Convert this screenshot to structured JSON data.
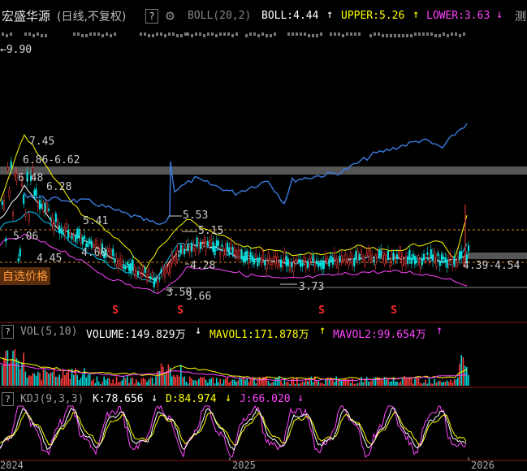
{
  "header": {
    "stock_name": "宏盛华源",
    "period": "(日线,不复权)",
    "help": "?",
    "indicator": "BOLL(20,2)",
    "boll_label": "BOLL:4.44",
    "upper_label": "UPPER:5.26",
    "lower_label": "LOWER:3.63",
    "trailing": "测",
    "colors": {
      "boll": "#ffffff",
      "upper": "#ffff00",
      "lower": "#ff44ff"
    }
  },
  "price_labels": {
    "max_price": "9.90",
    "h1": "7.45",
    "h2": "6.86-6.62",
    "h3": "6.48",
    "h4": "6.28",
    "h5": "5.41",
    "h6": "5.53",
    "h7": "5.15",
    "h8": "5.06",
    "h9": "4.45",
    "h10": "4.60",
    "h11": "4.28",
    "h12": "3.73",
    "h13": "3.50",
    "h14": "3.66",
    "h15": "4.39-4.54"
  },
  "self_select_label": "自选价格",
  "event_markers": [
    "S",
    "S",
    "S",
    "S"
  ],
  "volume_header": {
    "help": "?",
    "name": "VOL(5,10)",
    "volume": "VOLUME:149.829万",
    "mavol1": "MAVOL1:171.878万",
    "mavol2": "MAVOL2:99.654万"
  },
  "kdj_header": {
    "help": "?",
    "name": "KDJ(9,3,3)",
    "k": "K:78.656",
    "d": "D:84.974",
    "j": "J:66.020"
  },
  "x_axis": {
    "labels": [
      "2024",
      "2025",
      "2026"
    ]
  },
  "chart_data": [
    {
      "type": "line",
      "title": "BOLL(20,2)",
      "series": [
        {
          "name": "BOLL",
          "last": 4.44,
          "color": "#ffffff"
        },
        {
          "name": "UPPER",
          "last": 5.26,
          "color": "#ffff00"
        },
        {
          "name": "LOWER",
          "last": 3.63,
          "color": "#ff44ff"
        }
      ],
      "annotations": [
        9.9,
        7.45,
        6.86,
        6.62,
        6.48,
        6.28,
        5.41,
        5.53,
        5.15,
        5.06,
        4.45,
        4.6,
        4.28,
        3.73,
        3.5,
        3.66,
        4.39,
        4.54
      ]
    },
    {
      "type": "bar",
      "title": "VOL(5,10)",
      "series": [
        {
          "name": "VOLUME",
          "last": "149.829万"
        },
        {
          "name": "MAVOL1",
          "last": "171.878万"
        },
        {
          "name": "MAVOL2",
          "last": "99.654万"
        }
      ]
    },
    {
      "type": "line",
      "title": "KDJ(9,3,3)",
      "series": [
        {
          "name": "K",
          "last": 78.656,
          "color": "#ffffff"
        },
        {
          "name": "D",
          "last": 84.974,
          "color": "#ffff00"
        },
        {
          "name": "J",
          "last": 66.02,
          "color": "#ff44ff"
        }
      ]
    }
  ]
}
